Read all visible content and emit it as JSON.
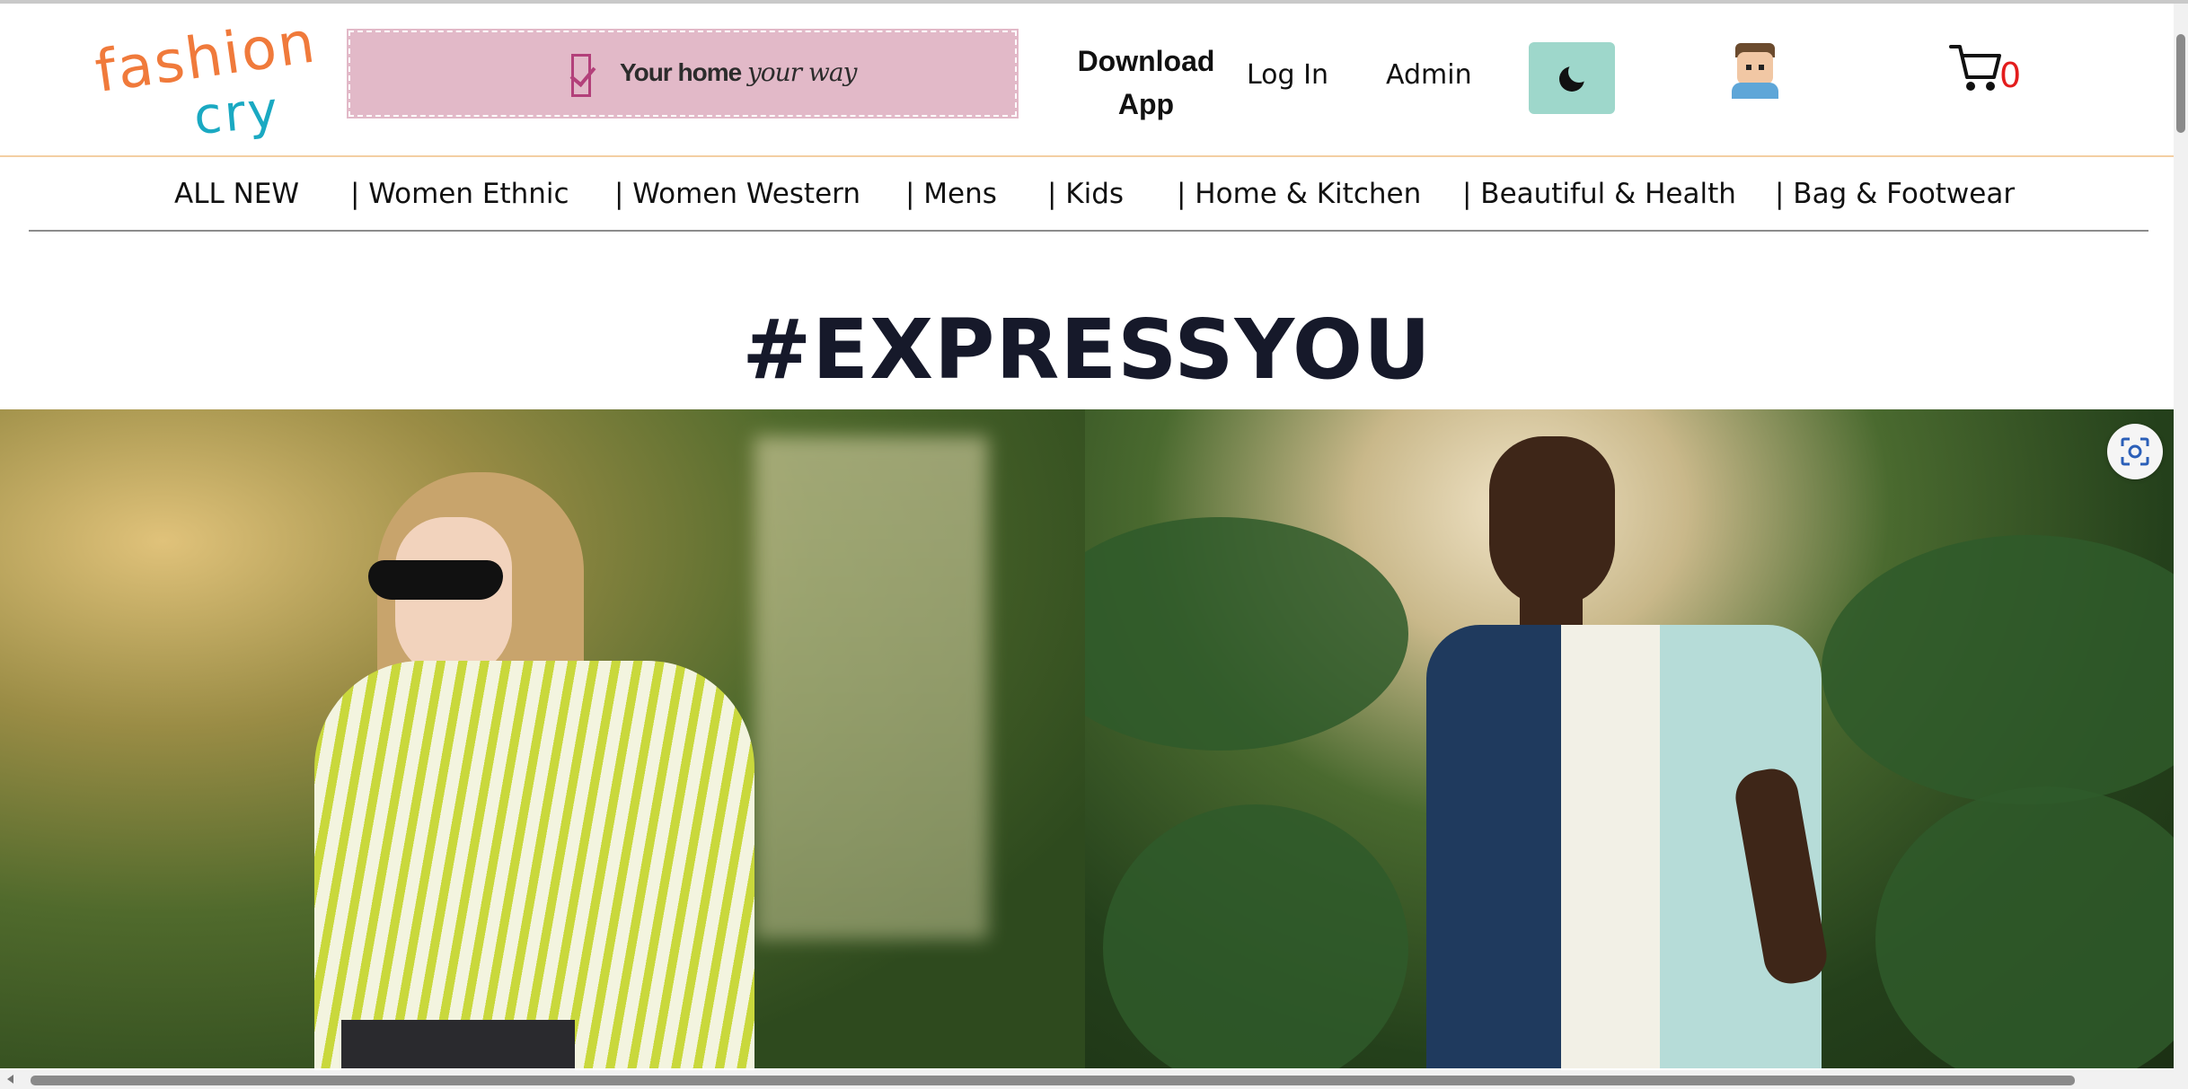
{
  "logo": {
    "line1": "fashion",
    "line2": "cry"
  },
  "banner": {
    "text": "Your home",
    "text_script": "your way",
    "icon": "checkbox-icon"
  },
  "header": {
    "download_label": "Download App",
    "login_label": "Log In",
    "admin_label": "Admin",
    "theme_icon": "moon-icon",
    "avatar_icon": "avatar",
    "cart_icon": "cart-icon",
    "cart_count": "0",
    "accent_color": "#9ed7cb"
  },
  "nav": {
    "items": [
      "ALL NEW",
      "| Women Ethnic",
      "| Women Western",
      "| Mens",
      "| Kids",
      "| Home & Kitchen",
      "| Beautiful & Health",
      "| Bag & Footwear"
    ]
  },
  "hero": {
    "title": "#EXPRESSYOU",
    "scan_icon": "visual-search-icon"
  }
}
